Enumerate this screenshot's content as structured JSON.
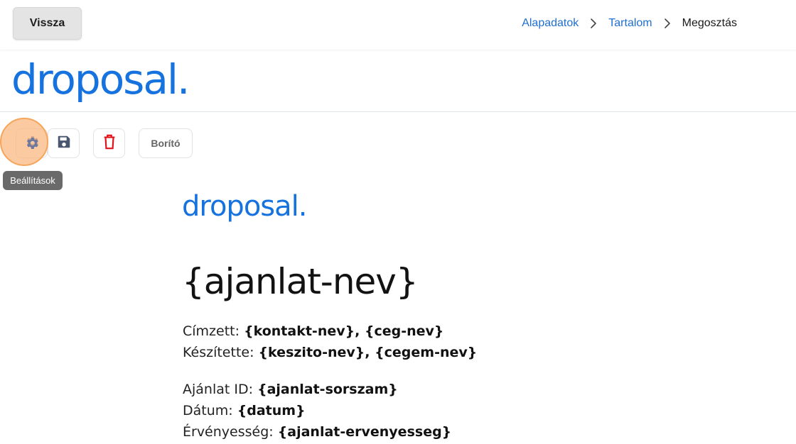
{
  "header": {
    "back_label": "Vissza",
    "breadcrumb": {
      "item1": "Alapadatok",
      "item2": "Tartalom",
      "current": "Megosztás"
    }
  },
  "brand": {
    "logo_text": "droposal.",
    "color": "#1572de"
  },
  "toolbar": {
    "settings_icon": "gear-icon",
    "save_icon": "floppy-disk-icon",
    "delete_icon": "trash-icon",
    "cover_label": "Borító",
    "tooltip": "Beállítások"
  },
  "document": {
    "logo_text": "droposal.",
    "title": "{ajanlat-nev}",
    "recipient_label": "Címzett:",
    "recipient_value": "{kontakt-nev}, {ceg-nev}",
    "author_label": "Készítette:",
    "author_value": "{keszito-nev}, {cegem-nev}",
    "id_label": "Ajánlat ID:",
    "id_value": "{ajanlat-sorszam}",
    "date_label": "Dátum:",
    "date_value": "{datum}",
    "validity_label": "Érvényesség:",
    "validity_value": "{ajanlat-ervenyesseg}"
  }
}
